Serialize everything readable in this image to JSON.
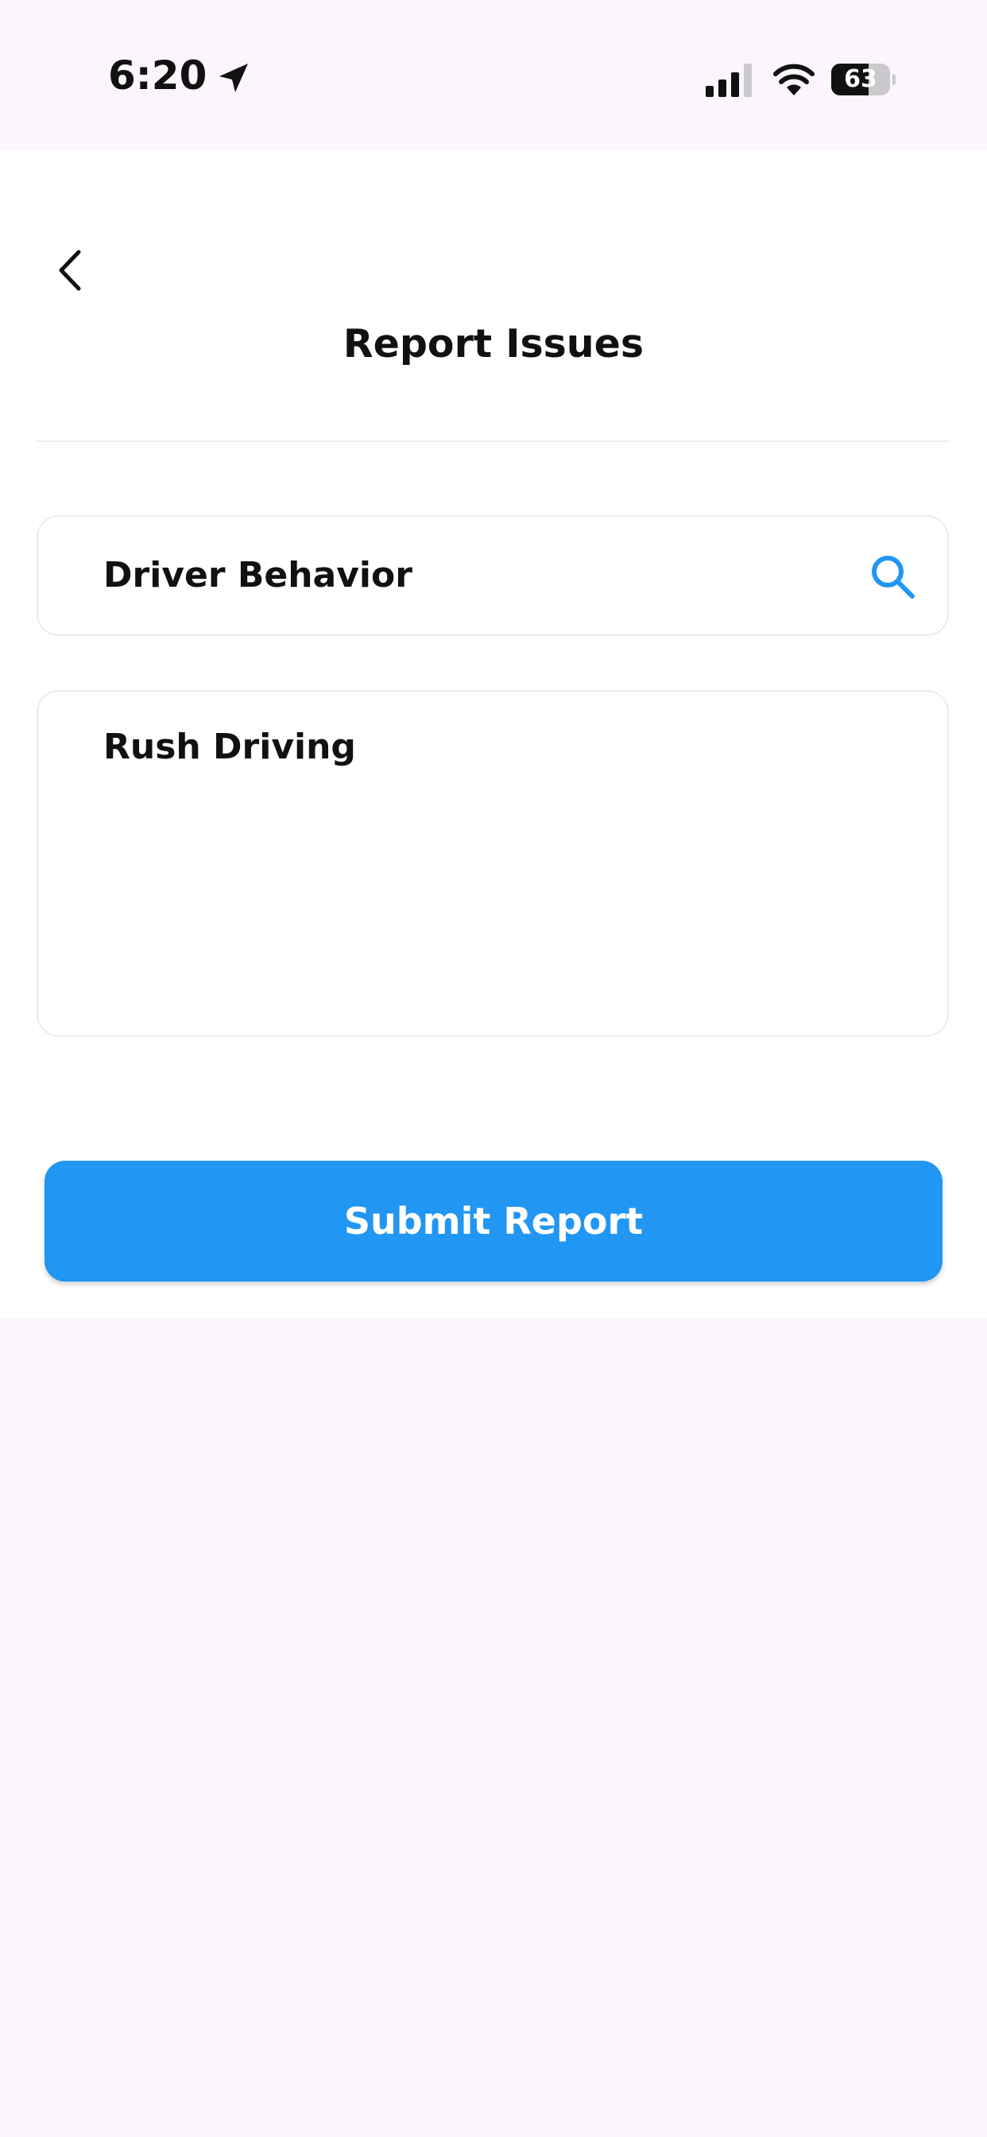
{
  "status_bar": {
    "time": "6:20",
    "battery_level": "63",
    "battery_fraction": 0.63,
    "icons": [
      "location-arrow-icon",
      "cellular-signal-icon",
      "wifi-icon",
      "battery-icon"
    ]
  },
  "header": {
    "back_icon": "chevron-left-icon",
    "title": "Report Issues"
  },
  "form": {
    "category_value": "Driver Behavior",
    "search_icon": "search-icon",
    "description_value": "Rush Driving"
  },
  "actions": {
    "submit_label": "Submit Report"
  },
  "colors": {
    "accent": "#2196f3",
    "background": "#fcf5fd",
    "card": "#ffffff",
    "border": "#ececec"
  }
}
